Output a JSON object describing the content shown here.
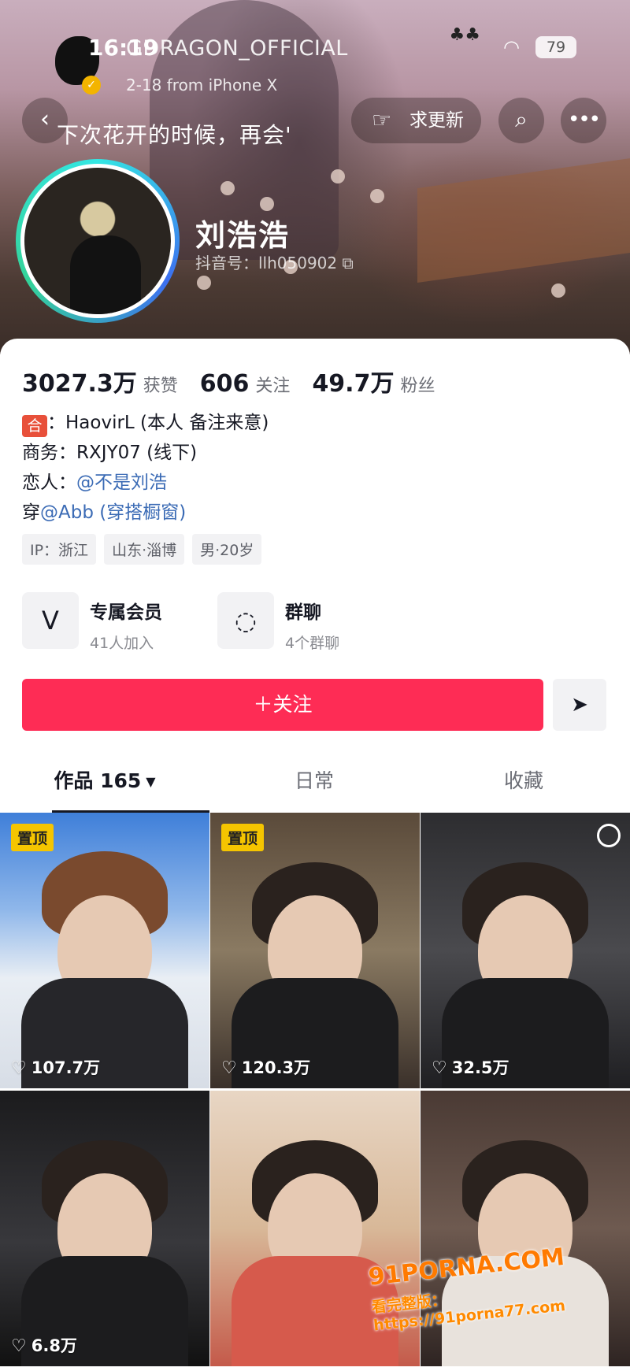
{
  "status_bar": {
    "time": "16:19",
    "battery": "79"
  },
  "cover_post": {
    "account": "GDRAGON_OFFICIAL",
    "meta": "2-18  from iPhone X",
    "text": "下次花开的时候，再会'"
  },
  "header_actions": {
    "request_update": "求更新"
  },
  "profile": {
    "nickname": "刘浩浩",
    "douyin_id": "抖音号：llh050902"
  },
  "stats": [
    {
      "num": "3027.3万",
      "label": "获赞"
    },
    {
      "num": "606",
      "label": "关注"
    },
    {
      "num": "49.7万",
      "label": "粉丝"
    }
  ],
  "bio": {
    "he_badge": "合",
    "line1": "：HaovirL (本人 备注来意)",
    "line2": "商务：RXJY07 (线下)",
    "line3_prefix": "恋人：",
    "line3_link": "@不是刘浩",
    "line4_prefix": "穿",
    "line4_link": "@Abb (穿搭橱窗)"
  },
  "tags": [
    "IP：浙江",
    "山东·淄博",
    "男·20岁"
  ],
  "features": [
    {
      "title": "专属会员",
      "sub": "41人加入"
    },
    {
      "title": "群聊",
      "sub": "4个群聊"
    }
  ],
  "follow_label": "＋关注",
  "tabs": [
    {
      "label": "作品 165"
    },
    {
      "label": "日常"
    },
    {
      "label": "收藏"
    }
  ],
  "videos": [
    {
      "pinned": "置顶",
      "likes": "107.7万"
    },
    {
      "pinned": "置顶",
      "likes": "120.3万"
    },
    {
      "pinned": "",
      "likes": "32.5万"
    },
    {
      "pinned": "",
      "likes": "6.8万"
    },
    {
      "pinned": "",
      "likes": ""
    },
    {
      "pinned": "",
      "likes": ""
    }
  ],
  "watermark": {
    "line1": "91PORNA.COM",
    "line2": "看完整版：https://91porna77.com"
  },
  "colors": {
    "follow": "#fe2c55",
    "link": "#3b6bb5",
    "pin": "#f5c500"
  }
}
